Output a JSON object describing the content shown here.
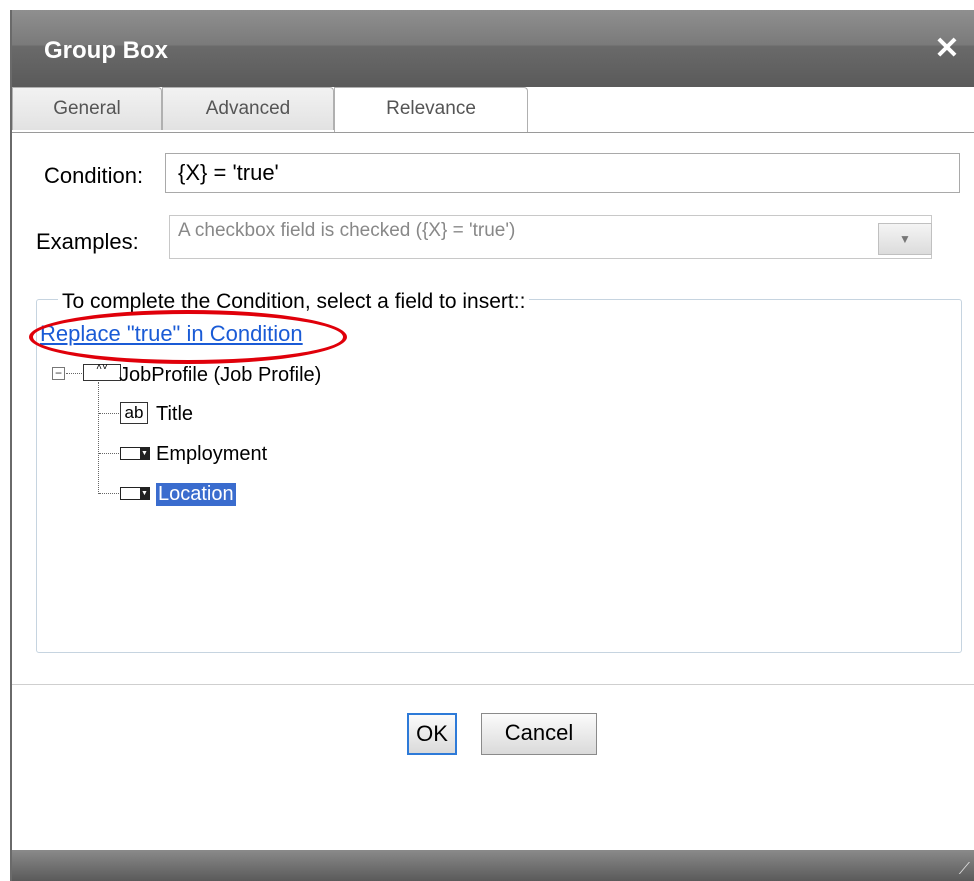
{
  "dialog": {
    "title": "Group Box",
    "close_glyph": "✕"
  },
  "tabs": [
    {
      "label": "General"
    },
    {
      "label": "Advanced"
    },
    {
      "label": "Relevance",
      "active": true
    }
  ],
  "condition": {
    "label": "Condition:",
    "value": "{X} = 'true'"
  },
  "examples": {
    "label": "Examples:",
    "selected": "A checkbox field is checked ({X} = 'true')",
    "arrow": "▼"
  },
  "fieldset": {
    "legend": "To complete the Condition, select a field to insert::"
  },
  "replace_link": "Replace \"true\" in Condition",
  "tree": {
    "root": {
      "label": "JobProfile (Job Profile)",
      "expander": "−"
    },
    "children": [
      {
        "label": "Title",
        "icon": "text-field-icon",
        "icon_text": "ab"
      },
      {
        "label": "Employment",
        "icon": "dropdown-field-icon"
      },
      {
        "label": "Location",
        "icon": "dropdown-field-icon",
        "selected": true
      }
    ]
  },
  "buttons": {
    "ok": "OK",
    "cancel": "Cancel"
  },
  "colors": {
    "highlight": "#e0000a",
    "selection": "#3a6cce",
    "link": "#1a5bd6"
  }
}
